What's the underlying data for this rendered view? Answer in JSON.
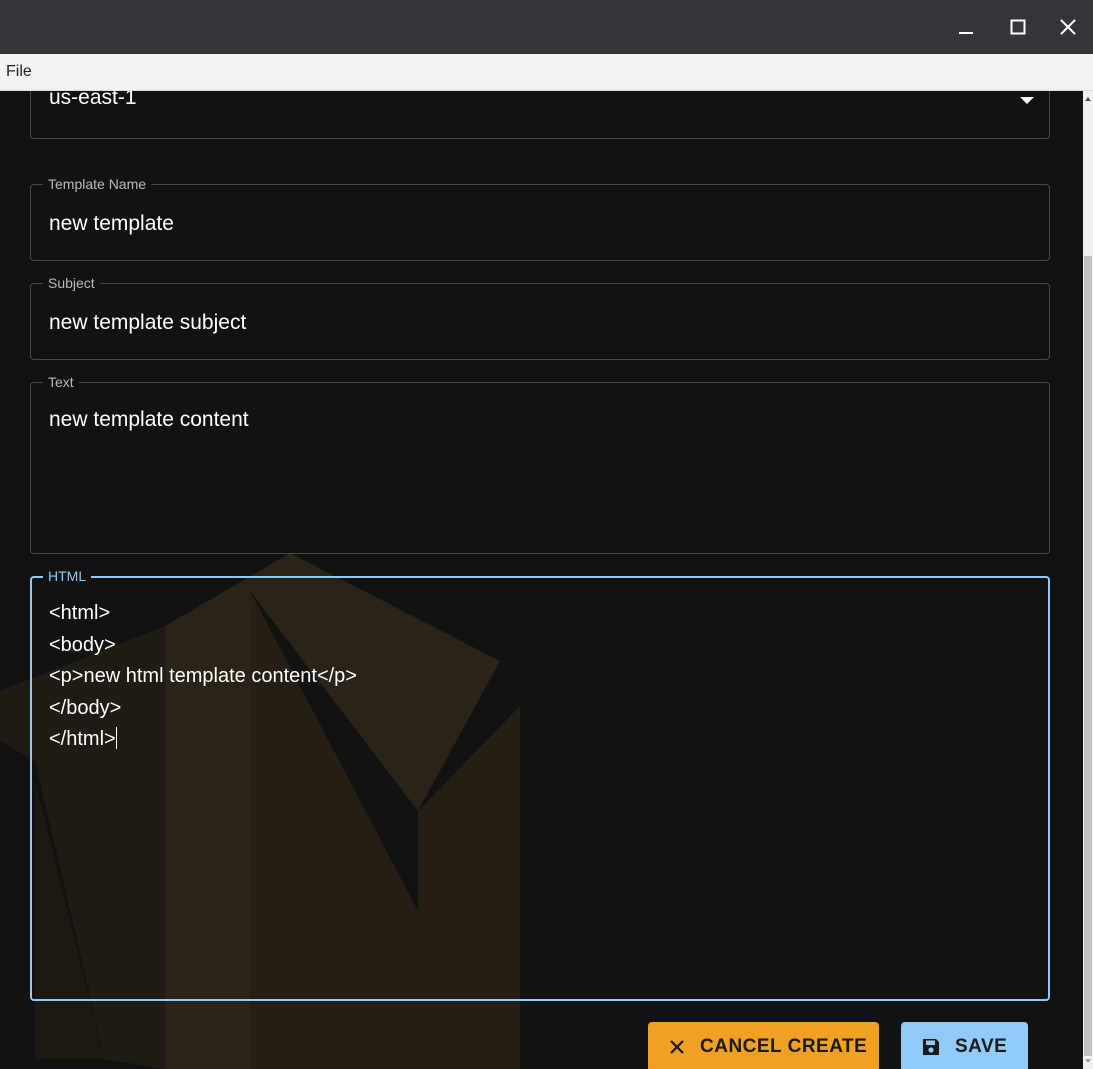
{
  "window": {
    "controls": {
      "minimize_icon": "minimize-icon",
      "maximize_icon": "maximize-icon",
      "close_icon": "close-icon"
    },
    "titlebar_color": "#35363a"
  },
  "menu": {
    "items": [
      {
        "label": "File"
      }
    ]
  },
  "form": {
    "region": {
      "value": "us-east-1",
      "icon": "arrow-drop-down-icon"
    },
    "template_name": {
      "label": "Template Name",
      "value": "new template"
    },
    "subject": {
      "label": "Subject",
      "value": "new template subject"
    },
    "text": {
      "label": "Text",
      "value": "new template content"
    },
    "html": {
      "label": "HTML",
      "lines": [
        "<html>",
        "<body>",
        "<p>new html template content</p>",
        "</body>",
        "</html>"
      ]
    }
  },
  "actions": {
    "cancel": {
      "label": "CANCEL CREATE",
      "icon": "close-icon",
      "color": "#f0a022"
    },
    "save": {
      "label": "SAVE",
      "icon": "save-icon",
      "color": "#90caf9"
    }
  },
  "theme": {
    "background": "#121212",
    "focus_color": "#90caf9",
    "watermark_color": "#2b2417"
  }
}
